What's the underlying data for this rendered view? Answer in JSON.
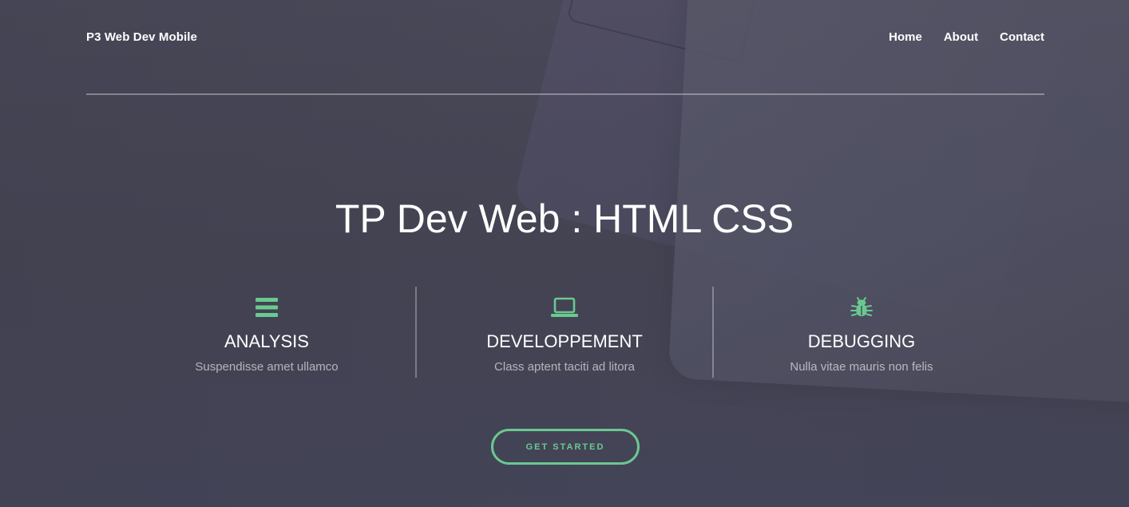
{
  "header": {
    "brand": "P3 Web Dev Mobile"
  },
  "nav": {
    "items": [
      {
        "label": "Home"
      },
      {
        "label": "About"
      },
      {
        "label": "Contact"
      }
    ]
  },
  "hero": {
    "title": "TP Dev Web : HTML CSS",
    "cta_label": "GET STARTED"
  },
  "features": [
    {
      "icon": "menu-bars-icon",
      "title": "ANALYSIS",
      "desc": "Suspendisse amet ullamco"
    },
    {
      "icon": "laptop-icon",
      "title": "DEVELOPPEMENT",
      "desc": "Class aptent taciti ad litora"
    },
    {
      "icon": "bug-icon",
      "title": "DEBUGGING",
      "desc": "Nulla vitae mauris non felis"
    }
  ],
  "colors": {
    "accent": "#6ac990",
    "background": "#484857"
  }
}
